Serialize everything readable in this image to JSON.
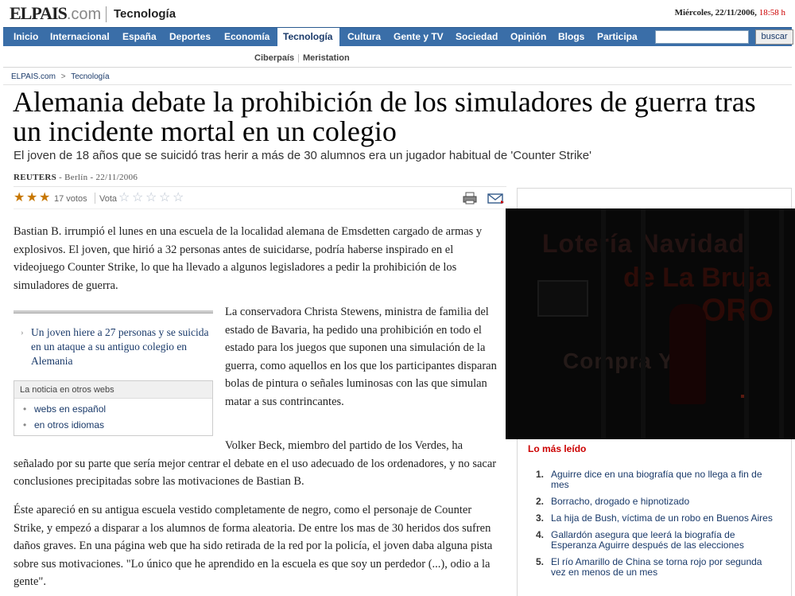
{
  "header": {
    "logo_main": "ELPAIS",
    "logo_com": ".com",
    "section": "Tecnología",
    "date": "Miércoles, 22/11/2006,",
    "time": "18:58 h"
  },
  "nav": {
    "items": [
      "Inicio",
      "Internacional",
      "España",
      "Deportes",
      "Economía",
      "Tecnología",
      "Cultura",
      "Gente y TV",
      "Sociedad",
      "Opinión",
      "Blogs",
      "Participa"
    ],
    "active": "Tecnología",
    "search_value": "",
    "search_button": "buscar"
  },
  "subnav": {
    "items": [
      "Ciberpaís",
      "Meristation"
    ]
  },
  "breadcrumb": {
    "home": "ELPAIS.com",
    "sep": ">",
    "section": "Tecnología"
  },
  "article": {
    "headline": "Alemania debate la prohibición de los simuladores de guerra tras un incidente mortal en un colegio",
    "subtitle": "El joven de 18 años que se suicidó tras herir a más de 30 alumnos era un jugador habitual de 'Counter Strike'",
    "agency": "REUTERS",
    "byline_rest": " - Berlín - 22/11/2006",
    "rating": {
      "stars": 3,
      "max": 5,
      "votes_text": "17 votos",
      "vota_label": "Vota"
    },
    "paragraphs": [
      "Bastian B. irrumpió el lunes en una escuela de la localidad alemana de Emsdetten cargado de armas y explosivos. El joven, que hirió a 32 personas antes de suicidarse, podría haberse inspirado en el videojuego Counter Strike, lo que ha llevado a algunos legisladores a pedir la prohibición de los simuladores de guerra.",
      "La conservadora Christa Stewens, ministra de familia del estado de Bavaria, ha pedido una prohibición en todo el estado para los juegos que suponen una simulación de la guerra, como aquellos en los que los participantes disparan bolas de pintura o señales luminosas con las que simulan matar a sus contrincantes.",
      "Volker Beck, miembro del partido de los Verdes, ha señalado por su parte que sería mejor centrar el debate en el uso adecuado de los ordenadores, y no sacar conclusiones precipitadas sobre las motivaciones de Bastian B.",
      "Éste apareció en su antigua escuela vestido completamente de negro, como el personaje de Counter Strike, y empezó a disparar a los alumnos de forma aleatoria. De entre los mas de 30 heridos dos sufren daños graves. En una página web que ha sido retirada de la red por la policía, el joven daba alguna pista sobre sus motivaciones. \"Lo único que he aprendido en la escuela es que soy un perdedor (...), odio a la gente\"."
    ]
  },
  "related": {
    "link": "Un joven hiere a 27 personas y se suicida en un ataque a su antiguo colegio en Alemania",
    "other_webs_title": "La noticia en otros webs",
    "other_webs": [
      "webs en español",
      "en otros idiomas"
    ]
  },
  "ad": {
    "line1": "Lotería Navidad",
    "line2": "de La Bruja",
    "line3": "ORO",
    "line4": "Compra YA"
  },
  "most_read": {
    "title": "Lo más leído",
    "items": [
      "Aguirre dice en una biografía que no llega a fin de mes",
      "Borracho, drogado e hipnotizado",
      "La hija de Bush, víctima de un robo en Buenos Aires",
      "Gallardón asegura que leerá la biografía de Esperanza Aguirre después de las elecciones",
      "El río Amarillo de China se torna rojo por segunda vez en menos de un mes"
    ]
  },
  "colors": {
    "nav": "#3a6ea8",
    "link": "#1a3a6a",
    "star": "#c77700",
    "accent": "#cc0000"
  }
}
